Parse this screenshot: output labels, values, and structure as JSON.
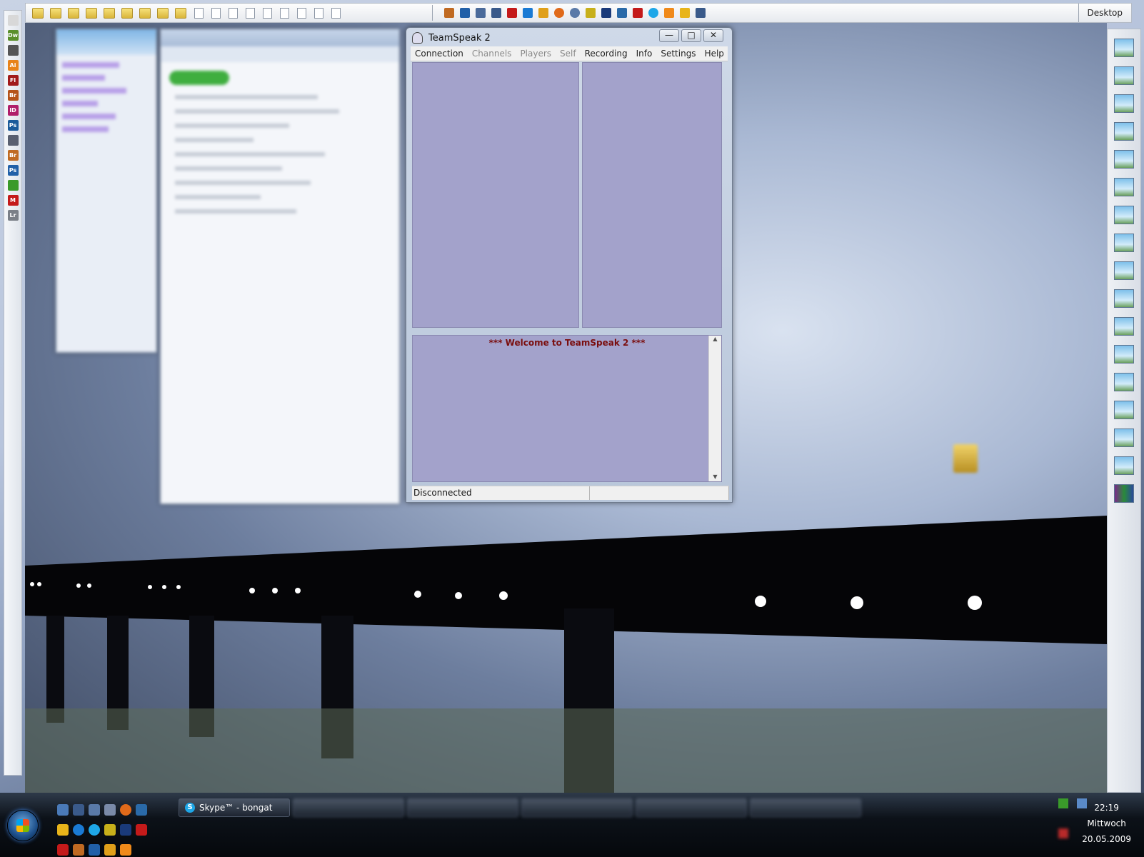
{
  "topbar": {
    "desktop_label": "Desktop",
    "overflow": "»"
  },
  "teamspeak": {
    "title": "TeamSpeak 2",
    "menu": [
      {
        "label": "Connection",
        "enabled": true
      },
      {
        "label": "Channels",
        "enabled": false
      },
      {
        "label": "Players",
        "enabled": false
      },
      {
        "label": "Self",
        "enabled": false
      },
      {
        "label": "Recording",
        "enabled": true
      },
      {
        "label": "Info",
        "enabled": true
      },
      {
        "label": "Settings",
        "enabled": true
      },
      {
        "label": "Help",
        "enabled": true
      }
    ],
    "welcome": "*** Welcome to TeamSpeak 2 ***",
    "status": "Disconnected",
    "controls": {
      "minimize": "—",
      "maximize": "□",
      "close": "✕"
    }
  },
  "leftdock": {
    "icons": [
      {
        "name": "acrobat-icon",
        "label": "",
        "color": "#d8d8d8"
      },
      {
        "name": "dreamweaver-icon",
        "label": "Dw",
        "color": "#5a8f2a"
      },
      {
        "name": "media-icon",
        "label": "",
        "color": "#555555"
      },
      {
        "name": "illustrator-icon",
        "label": "Ai",
        "color": "#e8831a"
      },
      {
        "name": "flash-icon",
        "label": "Fl",
        "color": "#a11a1a"
      },
      {
        "name": "bridge-icon",
        "label": "Br",
        "color": "#b5531a"
      },
      {
        "name": "indesign-icon",
        "label": "ID",
        "color": "#b01e6a"
      },
      {
        "name": "photoshop-icon",
        "label": "Ps",
        "color": "#1b5b9a"
      },
      {
        "name": "teamspeak-icon",
        "label": "",
        "color": "#5a6070"
      },
      {
        "name": "bridge-icon-2",
        "label": "Br",
        "color": "#c06a22"
      },
      {
        "name": "photoshop-icon-2",
        "label": "Ps",
        "color": "#2160a8"
      },
      {
        "name": "utorrent-icon",
        "label": "",
        "color": "#3a9a2a"
      },
      {
        "name": "mcafee-icon",
        "label": "M",
        "color": "#c41a1a"
      },
      {
        "name": "lightroom-icon",
        "label": "Lr",
        "color": "#7a7f87"
      }
    ]
  },
  "taskbar": {
    "skype_button": "Skype™ - bongat",
    "clock": {
      "time": "22:19",
      "day": "Mittwoch",
      "date": "20.05.2009"
    }
  }
}
